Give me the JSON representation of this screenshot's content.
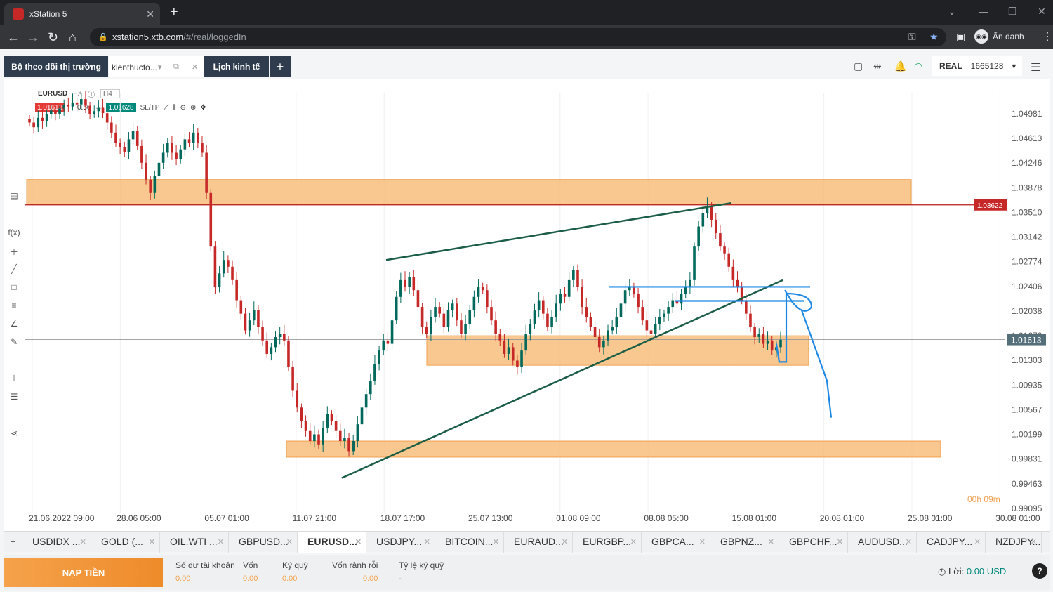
{
  "browser": {
    "tab_title": "xStation 5",
    "tab_close": "✕",
    "new_tab": "+",
    "url_host": "xstation5.xtb.com",
    "url_path": "/#/real/loggedIn",
    "incognito_label": "Ẩn danh"
  },
  "toolbar": {
    "market_watch": "Bộ theo dõi thị trường",
    "workspace_name": "kienthucfo...",
    "economic_calendar": "Lịch kinh tế",
    "add": "+",
    "account_type": "REAL",
    "account_number": "1665128"
  },
  "chart_header": {
    "symbol": "EURUSD",
    "market": "FX",
    "timeframe": "H4",
    "sell_price": "1.01613",
    "spread": "0.50",
    "buy_price": "1.01628",
    "sltp": "SL/TP"
  },
  "chart_data": {
    "type": "candlestick",
    "y_axis_labels": [
      "1.04981",
      "1.04613",
      "1.04246",
      "1.03878",
      "1.03510",
      "1.03142",
      "1.02774",
      "1.02406",
      "1.02038",
      "1.01670",
      "1.01303",
      "1.00935",
      "1.00567",
      "1.00199",
      "0.99831",
      "0.99463",
      "0.99095"
    ],
    "x_axis_labels": [
      "21.06.2022 09:00",
      "28.06 05:00",
      "05.07 01:00",
      "11.07 21:00",
      "18.07 17:00",
      "25.07 13:00",
      "01.08 09:00",
      "08.08 05:00",
      "15.08 01:00",
      "20.08 01:00",
      "25.08 01:00",
      "30.08 01:00"
    ],
    "current_price_label": "1.01613",
    "horizontal_line_label": "1.03622",
    "countdown": "00h 09m",
    "colors": {
      "up": "#00695c",
      "down": "#c62828",
      "zone": "#f7b56b",
      "trend": "#1b5e45",
      "drawing": "#1e88e5"
    },
    "closes": [
      1.0485,
      1.0478,
      1.0492,
      1.0487,
      1.0497,
      1.0503,
      1.0498,
      1.0506,
      1.0511,
      1.0509,
      1.0515,
      1.0512,
      1.052,
      1.051,
      1.0498,
      1.0502,
      1.0507,
      1.0499,
      1.0485,
      1.047,
      1.0455,
      1.0448,
      1.0441,
      1.046,
      1.0472,
      1.045,
      1.0425,
      1.04,
      1.038,
      1.0405,
      1.0425,
      1.044,
      1.0455,
      1.044,
      1.043,
      1.0445,
      1.046,
      1.0455,
      1.047,
      1.0455,
      1.044,
      1.038,
      1.03,
      1.024,
      1.026,
      1.028,
      1.027,
      1.025,
      1.022,
      1.02,
      1.0175,
      1.019,
      1.0205,
      1.018,
      1.016,
      1.014,
      1.015,
      1.0165,
      1.017,
      1.016,
      1.012,
      1.0085,
      1.006,
      1.004,
      1.0025,
      1.001,
      1.002,
      1.0005,
      1.003,
      1.005,
      1.004,
      1.0025,
      1.001,
      1.0015,
      0.9995,
      1.001,
      1.0035,
      1.006,
      1.008,
      1.01,
      1.0125,
      1.0145,
      1.016,
      1.0155,
      1.019,
      1.0225,
      1.025,
      1.024,
      1.0255,
      1.0235,
      1.021,
      1.018,
      1.017,
      1.0195,
      1.021,
      1.02,
      1.018,
      1.0205,
      1.0215,
      1.019,
      1.017,
      1.0185,
      1.0205,
      1.0225,
      1.024,
      1.0235,
      1.021,
      1.019,
      1.017,
      1.016,
      1.014,
      1.015,
      1.013,
      1.012,
      1.0145,
      1.017,
      1.0185,
      1.0205,
      1.022,
      1.02,
      1.018,
      1.0195,
      1.0215,
      1.023,
      1.0225,
      1.025,
      1.0265,
      1.024,
      1.021,
      1.0195,
      1.018,
      1.0165,
      1.015,
      1.016,
      1.0175,
      1.018,
      1.0195,
      1.0215,
      1.0235,
      1.024,
      1.023,
      1.021,
      1.019,
      1.0175,
      1.017,
      1.0185,
      1.0195,
      1.02,
      1.021,
      1.022,
      1.0215,
      1.023,
      1.024,
      1.025,
      1.03,
      1.033,
      1.035,
      1.036,
      1.034,
      1.032,
      1.03,
      1.029,
      1.027,
      1.025,
      1.024,
      1.022,
      1.02,
      1.018,
      1.0165,
      1.017,
      1.0155,
      1.016,
      1.0145,
      1.015,
      1.0161
    ]
  },
  "symbol_tabs": [
    "USDIDX ...",
    "GOLD (...",
    "OIL.WTI ...",
    "GBPUSD...",
    "EURUSD...",
    "USDJPY...",
    "BITCOIN...",
    "EURAUD...",
    "EURGBP...",
    "GBPCA...",
    "GBPNZ...",
    "GBPCHF...",
    "AUDUSD...",
    "CADJPY...",
    "NZDJPY..."
  ],
  "footer": {
    "deposit": "NẠP TIỀN",
    "balance_label": "Số dư tài khoản",
    "balance_value": "0.00",
    "equity_label": "Vốn",
    "equity_value": "0.00",
    "margin_label": "Ký quỹ",
    "margin_value": "0.00",
    "free_margin_label": "Vốn rảnh rỗi",
    "free_margin_value": "0.00",
    "margin_level_label": "Tỷ lệ ký quỹ",
    "margin_level_value": "-",
    "profit_label": "Lời:",
    "profit_value": "0.00 USD",
    "help": "?"
  }
}
